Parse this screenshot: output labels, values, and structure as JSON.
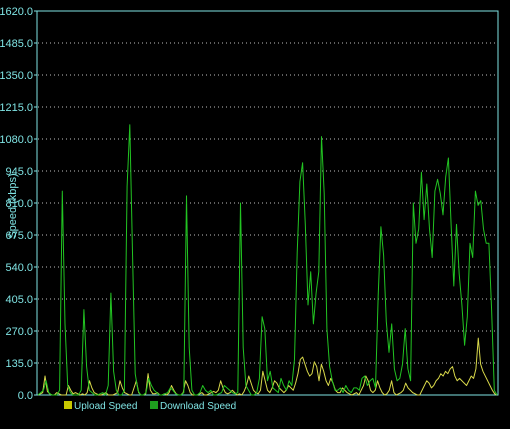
{
  "chart_data": {
    "type": "line",
    "title": "",
    "xlabel": "",
    "ylabel": "Speed (kbps)",
    "ylim": [
      0,
      1620
    ],
    "yticks": [
      "0.0",
      "135.0",
      "270.0",
      "405.0",
      "540.0",
      "675.0",
      "810.0",
      "945.0",
      "1080.0",
      "1215.0",
      "1350.0",
      "1485.0",
      "1620.0"
    ],
    "grid": true,
    "legend": "bottom-left",
    "colors": {
      "background": "#000000",
      "axis": "#7fe3e3",
      "grid": "#ffffff",
      "upload": "#d8d84a",
      "download": "#22c422",
      "upload_swatch": "#c8c800",
      "download_swatch": "#1e9e1e"
    },
    "series": [
      {
        "name": "Upload Speed",
        "values": [
          0,
          5,
          10,
          80,
          15,
          5,
          0,
          0,
          10,
          5,
          0,
          0,
          0,
          40,
          20,
          5,
          10,
          5,
          0,
          5,
          0,
          10,
          60,
          30,
          10,
          5,
          0,
          0,
          5,
          10,
          0,
          0,
          0,
          5,
          10,
          60,
          30,
          10,
          5,
          0,
          0,
          30,
          60,
          10,
          0,
          0,
          5,
          90,
          20,
          5,
          5,
          10,
          0,
          0,
          5,
          0,
          10,
          40,
          20,
          5,
          0,
          0,
          10,
          60,
          40,
          10,
          0,
          0,
          0,
          5,
          10,
          0,
          0,
          5,
          10,
          15,
          10,
          20,
          60,
          30,
          10,
          5,
          10,
          20,
          10,
          0,
          5,
          0,
          15,
          40,
          80,
          50,
          20,
          10,
          5,
          20,
          100,
          60,
          20,
          10,
          30,
          60,
          50,
          30,
          20,
          10,
          20,
          40,
          30,
          20,
          50,
          90,
          150,
          160,
          130,
          100,
          80,
          90,
          140,
          120,
          60,
          130,
          100,
          60,
          40,
          70,
          50,
          20,
          10,
          10,
          30,
          20,
          10,
          5,
          0,
          5,
          10,
          0,
          20,
          40,
          80,
          60,
          20,
          10,
          20,
          60,
          30,
          10,
          0,
          5,
          20,
          60,
          10,
          0,
          5,
          10,
          20,
          50,
          30,
          20,
          10,
          5,
          0,
          0,
          20,
          40,
          60,
          50,
          30,
          40,
          60,
          70,
          90,
          80,
          100,
          90,
          110,
          120,
          80,
          60,
          70,
          60,
          50,
          40,
          60,
          80,
          70,
          110,
          240,
          130,
          100,
          80,
          60,
          40,
          20,
          5,
          0
        ],
        "stats_note": ""
      },
      {
        "name": "Download Speed",
        "values": [
          0,
          10,
          20,
          60,
          10,
          0,
          0,
          0,
          20,
          860,
          300,
          40,
          10,
          0,
          0,
          0,
          20,
          360,
          120,
          20,
          10,
          0,
          0,
          5,
          10,
          0,
          40,
          430,
          100,
          20,
          0,
          0,
          20,
          880,
          1140,
          600,
          90,
          20,
          0,
          0,
          10,
          70,
          40,
          20,
          10,
          0,
          0,
          5,
          10,
          30,
          20,
          5,
          0,
          0,
          10,
          840,
          200,
          20,
          0,
          0,
          10,
          40,
          20,
          10,
          20,
          0,
          0,
          5,
          10,
          40,
          30,
          20,
          10,
          5,
          10,
          810,
          200,
          40,
          20,
          0,
          0,
          10,
          70,
          330,
          280,
          60,
          100,
          30,
          20,
          10,
          70,
          40,
          20,
          60,
          40,
          150,
          600,
          900,
          980,
          720,
          380,
          520,
          300,
          430,
          520,
          1090,
          850,
          280,
          120,
          60,
          20,
          20,
          30,
          10,
          40,
          20,
          10,
          30,
          30,
          20,
          70,
          80,
          40,
          60,
          70,
          30,
          420,
          710,
          590,
          310,
          180,
          300,
          110,
          60,
          70,
          130,
          280,
          110,
          60,
          810,
          640,
          700,
          940,
          740,
          890,
          700,
          580,
          860,
          910,
          850,
          760,
          920,
          1000,
          720,
          460,
          720,
          510,
          380,
          210,
          330,
          640,
          580,
          860,
          800,
          820,
          700,
          640,
          640,
          360,
          20,
          0
        ]
      }
    ]
  }
}
